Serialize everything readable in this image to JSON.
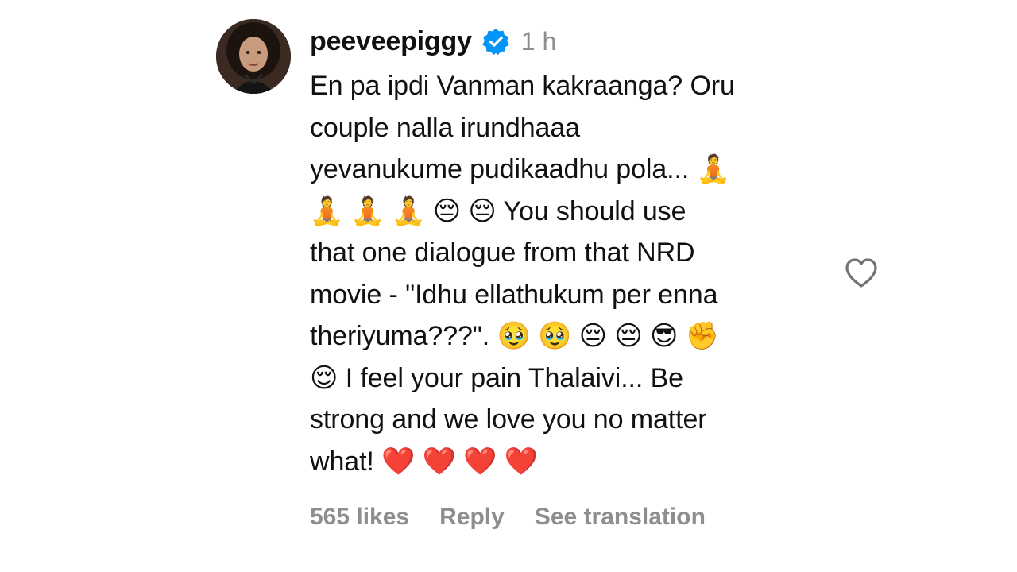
{
  "comment": {
    "username": "peeveepiggy",
    "verified": true,
    "time": "1 h",
    "text": "En pa ipdi Vanman kakraanga? Oru\ncouple nalla irundhaaa\nyevanukume pudikaadhu pola... 🧘\n🧘 🧘 🧘 😔 😔 You should use\nthat one dialogue from that NRD\nmovie - \"Idhu ellathukum per enna\ntheriyuma???\". 🥹 🥹 😔 😔 😎 ✊\n😌 I feel your pain Thalaivi... Be\nstrong and we love you no matter\nwhat! ❤️ ❤️ ❤️ ❤️",
    "likes": "565 likes",
    "reply_label": "Reply",
    "translation_label": "See translation"
  },
  "icons": {
    "avatar": "profile-picture",
    "verified": "verified-badge-icon",
    "like": "heart-outline-icon"
  },
  "colors": {
    "verified_blue": "#0095f6",
    "secondary_text": "#8e8e8e",
    "primary_text": "#111111"
  }
}
